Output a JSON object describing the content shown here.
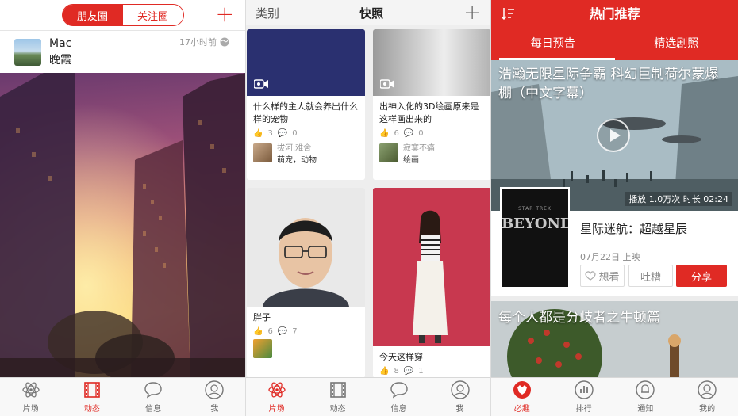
{
  "screen1": {
    "segment": {
      "left": "朋友圈",
      "right": "关注圈"
    },
    "post": {
      "username": "Mac",
      "caption": "晚霞",
      "time": "17小时前"
    },
    "tabs": [
      {
        "label": "片场",
        "icon": "atom-icon"
      },
      {
        "label": "动态",
        "icon": "film-icon"
      },
      {
        "label": "信息",
        "icon": "chat-bubble-icon"
      },
      {
        "label": "我",
        "icon": "person-icon"
      }
    ],
    "active_tab": 1
  },
  "screen2": {
    "header": {
      "left": "类别",
      "title": "快照"
    },
    "cards": [
      {
        "title": "什么样的主人就会养出什么样的宠物",
        "likes": "3",
        "comments": "0",
        "author": "拔河.难舍",
        "tags": "萌宠，动物"
      },
      {
        "title": "出神入化的3D绘画原来是这样画出来的",
        "likes": "6",
        "comments": "0",
        "author": "寂寞不痛",
        "tags": "绘画"
      },
      {
        "title": "胖子",
        "likes": "6",
        "comments": "7"
      },
      {
        "title": "今天这样穿",
        "likes": "8",
        "comments": "1"
      }
    ],
    "tabs": [
      {
        "label": "片场",
        "icon": "atom-icon"
      },
      {
        "label": "动态",
        "icon": "film-icon"
      },
      {
        "label": "信息",
        "icon": "chat-bubble-icon"
      },
      {
        "label": "我",
        "icon": "person-icon"
      }
    ],
    "active_tab": 0
  },
  "screen3": {
    "header": {
      "title": "热门推荐"
    },
    "top_tabs": [
      "每日预告",
      "精选剧照"
    ],
    "video1": {
      "title": "浩瀚无限星际争霸 科幻巨制荷尔蒙爆棚（中文字幕）",
      "stats": "播放 1.0万次  时长 02:24"
    },
    "movie": {
      "poster_text": "BEYOND",
      "poster_top": "STAR TREK",
      "name": "星际迷航：超越星辰",
      "date": "07月22日 上映",
      "want": "想看",
      "tucao": "吐槽",
      "share": "分享"
    },
    "video2": {
      "title": "每个人都是分歧者之牛顿篇"
    },
    "tabs": [
      {
        "label": "必趣",
        "icon": "fox-icon"
      },
      {
        "label": "排行",
        "icon": "bar-chart-icon"
      },
      {
        "label": "通知",
        "icon": "bell-icon"
      },
      {
        "label": "我的",
        "icon": "person-icon"
      }
    ],
    "active_tab": 0
  },
  "colors": {
    "accent": "#e02a24"
  }
}
